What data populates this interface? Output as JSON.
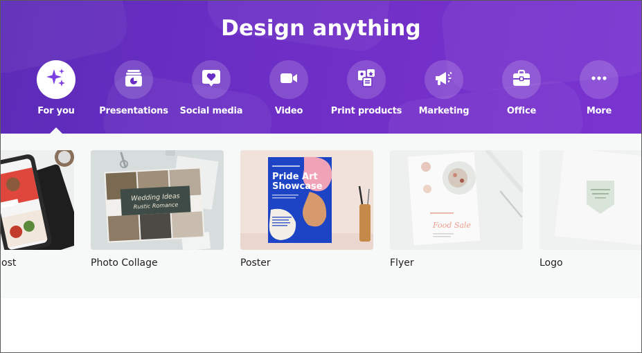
{
  "hero": {
    "title": "Design anything",
    "colors": {
      "gradient_start": "#5b2bb7",
      "gradient_end": "#7a34d0",
      "active_pointer": "#f7f8f8"
    }
  },
  "categories": [
    {
      "label": "For you",
      "icon": "sparkle-icon",
      "active": true
    },
    {
      "label": "Presentations",
      "icon": "presentation-icon",
      "active": false
    },
    {
      "label": "Social media",
      "icon": "heart-chat-icon",
      "active": false
    },
    {
      "label": "Video",
      "icon": "video-camera-icon",
      "active": false
    },
    {
      "label": "Print products",
      "icon": "print-products-icon",
      "active": false
    },
    {
      "label": "Marketing",
      "icon": "megaphone-icon",
      "active": false
    },
    {
      "label": "Office",
      "icon": "briefcase-icon",
      "active": false
    },
    {
      "label": "More",
      "icon": "more-dots-icon",
      "active": false
    }
  ],
  "templates": [
    {
      "caption": "ost",
      "thumbnail": "phone-instagram-thumbnail"
    },
    {
      "caption": "Photo Collage",
      "thumbnail": "photo-collage-thumbnail",
      "inner_text": [
        "Wedding Ideas",
        "Rustic Romance"
      ]
    },
    {
      "caption": "Poster",
      "thumbnail": "poster-thumbnail",
      "inner_text": [
        "Pride Art",
        "Showcase"
      ]
    },
    {
      "caption": "Flyer",
      "thumbnail": "flyer-thumbnail",
      "inner_text": [
        "Food Sale"
      ]
    },
    {
      "caption": "Logo",
      "thumbnail": "logo-thumbnail"
    }
  ]
}
